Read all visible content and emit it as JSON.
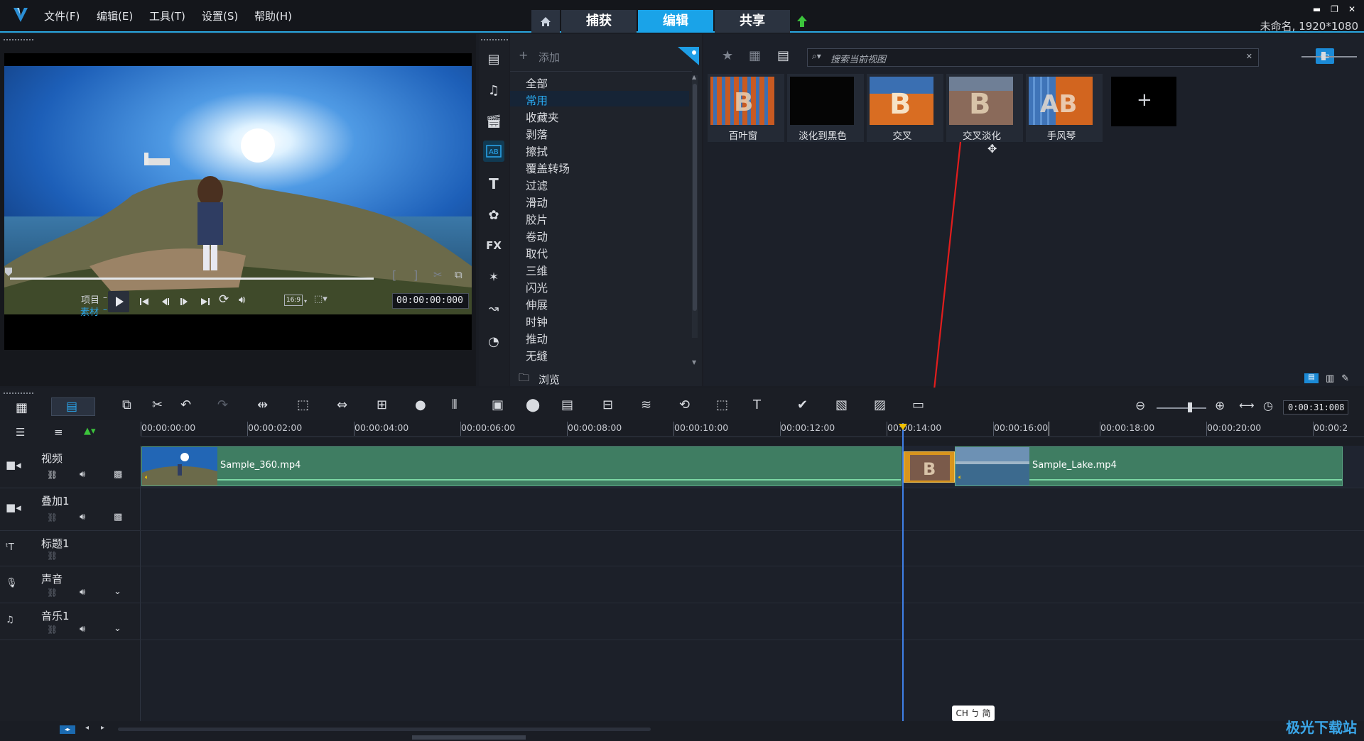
{
  "menu": [
    "文件(F)",
    "编辑(E)",
    "工具(T)",
    "设置(S)",
    "帮助(H)"
  ],
  "modes": [
    {
      "label": "捕获",
      "active": false
    },
    {
      "label": "编辑",
      "active": true
    },
    {
      "label": "共享",
      "active": false
    }
  ],
  "project_info": "未命名, 1920*1080",
  "preview": {
    "project_label": "项目",
    "clip_label": "素材",
    "aspect": "16:9",
    "timecode": "00:00:00:000"
  },
  "library": {
    "add_label": "添加",
    "browse_label": "浏览",
    "search_placeholder": "搜索当前视图",
    "categories": [
      "全部",
      "常用",
      "收藏夹",
      "剥落",
      "擦拭",
      "覆盖转场",
      "过滤",
      "滑动",
      "胶片",
      "卷动",
      "取代",
      "三维",
      "闪光",
      "伸展",
      "时钟",
      "推动",
      "无缝"
    ],
    "active_category": "常用",
    "thumbnails": [
      "百叶窗",
      "淡化到黑色",
      "交叉",
      "交叉淡化",
      "手风琴"
    ],
    "add_thumbnail_icon": "plus-icon"
  },
  "timeline": {
    "zoom_timecode": "0:00:31:008",
    "ruler_ticks": [
      "00:00:00:00",
      "00:00:02:00",
      "00:00:04:00",
      "00:00:06:00",
      "00:00:08:00",
      "00:00:10:00",
      "00:00:12:00",
      "00:00:14:00",
      "00:00:16:00",
      "00:00:18:00",
      "00:00:20:00",
      "00:00:2"
    ],
    "tracks": [
      "视频",
      "叠加1",
      "标题1",
      "声音",
      "音乐1"
    ],
    "clips": [
      "Sample_360.mp4",
      "Sample_Lake.mp4"
    ]
  },
  "ime_indicator": "CH ㄅ 简",
  "watermark": "极光下载站"
}
